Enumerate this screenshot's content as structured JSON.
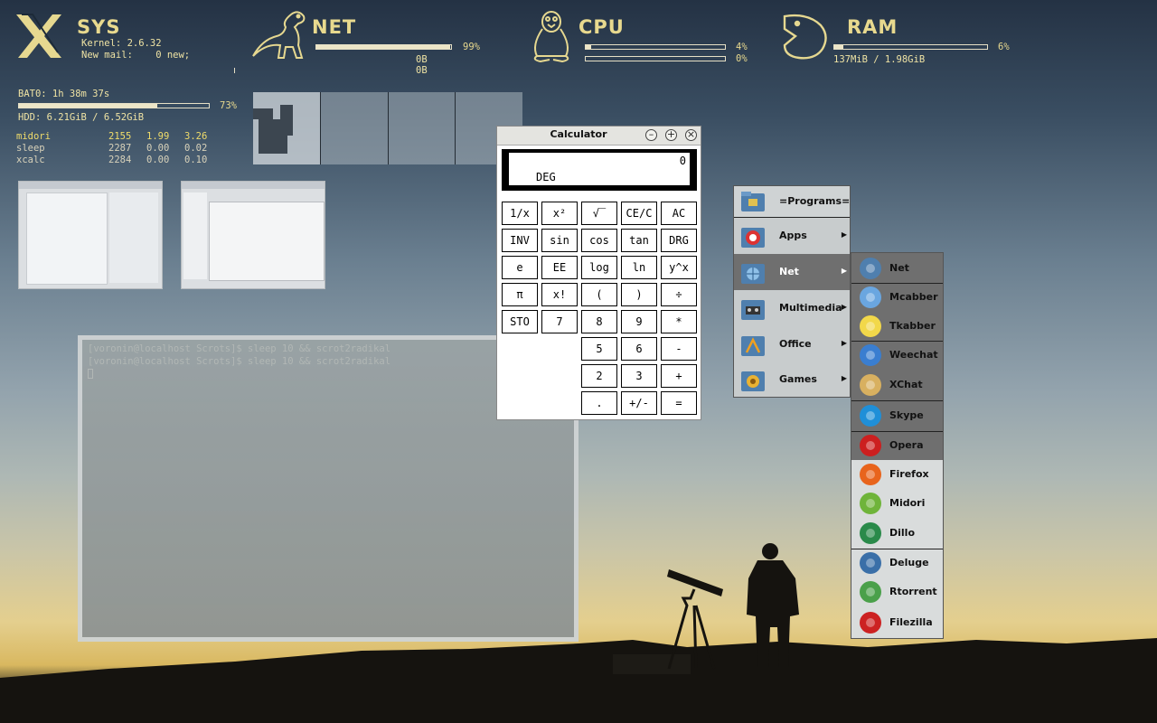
{
  "conky": {
    "sys": {
      "title": "SYS",
      "kernel_label": "Kernel:",
      "kernel_value": "2.6.32",
      "mail_label": "New mail:",
      "mail_value": "0 new;"
    },
    "net": {
      "title": "NET",
      "bar_pct": 0.99,
      "pct_label": "99%",
      "down": "0B",
      "up": "0B"
    },
    "cpu": {
      "title": "CPU",
      "bar1_pct": 0.04,
      "pct1_label": "4%",
      "bar2_pct": 0.0,
      "pct2_label": "0%"
    },
    "ram": {
      "title": "RAM",
      "bar_pct": 0.06,
      "pct_label": "6%",
      "usage": "137MiB / 1.98GiB"
    },
    "battery": {
      "label": "BAT0: 1h 38m 37s",
      "bar_pct": 0.73,
      "pct_label": "73%"
    },
    "hdd": {
      "label": "HDD: 6.21GiB / 6.52GiB"
    },
    "processes": [
      {
        "name": "midori",
        "pid": "2155",
        "cpu": "1.99",
        "mem": "3.26"
      },
      {
        "name": "sleep",
        "pid": "2287",
        "cpu": "0.00",
        "mem": "0.02"
      },
      {
        "name": "xcalc",
        "pid": "2284",
        "cpu": "0.00",
        "mem": "0.10"
      }
    ]
  },
  "terminal": {
    "lines": [
      "[voronin@localhost Scrots]$ sleep 10 && scrot2radikal",
      "[voronin@localhost Scrots]$ sleep 10 && scrot2radikal"
    ]
  },
  "calculator": {
    "title": "Calculator",
    "display_value": "0",
    "display_mode": "DEG",
    "rows": [
      [
        "1/x",
        "x²",
        "√‾",
        "CE/C",
        "AC"
      ],
      [
        "INV",
        "sin",
        "cos",
        "tan",
        "DRG"
      ],
      [
        "e",
        "EE",
        "log",
        "ln",
        "y^x"
      ],
      [
        "π",
        "x!",
        "(",
        ")",
        "÷"
      ],
      [
        "STO",
        "7",
        "8",
        "9",
        "*"
      ],
      [
        "",
        "",
        "5",
        "6",
        "-"
      ],
      [
        "",
        "",
        "2",
        "3",
        "+"
      ],
      [
        "",
        "",
        ".",
        "+/-",
        "="
      ]
    ]
  },
  "menu": {
    "main": [
      {
        "label": "=Programs=",
        "submenu": false
      },
      {
        "label": "Apps",
        "submenu": true
      },
      {
        "label": "Net",
        "submenu": true
      },
      {
        "label": "Multimedia",
        "submenu": true
      },
      {
        "label": "Office",
        "submenu": true
      },
      {
        "label": "Games",
        "submenu": true
      }
    ],
    "net_submenu": [
      "Net",
      "Mcabber",
      "Tkabber",
      "Weechat",
      "XChat",
      "Skype",
      "Opera",
      "Firefox",
      "Midori",
      "Dillo",
      "Deluge",
      "Rtorrent",
      "Filezilla"
    ]
  },
  "colors": {
    "accent": "#e8d98e",
    "menu_dark": "#6f6f6f",
    "menu_light": "#d9dcdc"
  }
}
